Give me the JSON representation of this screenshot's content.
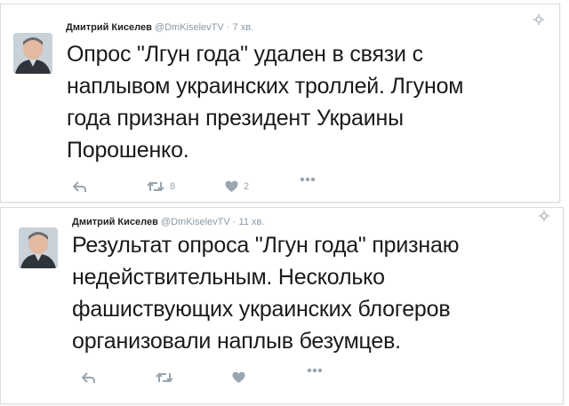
{
  "tweets": [
    {
      "author_name": "Дмитрий Киселев",
      "handle": "@DmKiselevTV",
      "separator": "·",
      "time": "7 хв.",
      "text_lines": [
        "Опрос \"Лгун года\" удален в связи с",
        "наплывом украинских троллей. Лгуном",
        "года признан президент Украины",
        "Порошенко."
      ],
      "retweet_count": "8",
      "like_count": "2",
      "icons": [
        "reply-icon",
        "retweet-icon",
        "like-icon",
        "more-icon",
        "follow-icon"
      ]
    },
    {
      "author_name": "Дмитрий Киселев",
      "handle": "@DmKiselevTV",
      "separator": "·",
      "time": "11 хв.",
      "text_lines": [
        "Результат опроса \"Лгун года\" признаю",
        "недействительным. Несколько",
        "фашиствующих украинских блогеров",
        "организовали наплыв безумцев."
      ],
      "retweet_count": "",
      "like_count": "",
      "icons": [
        "reply-icon",
        "retweet-icon",
        "like-icon",
        "more-icon",
        "follow-icon"
      ]
    }
  ],
  "colors": {
    "text": "#1a1a1a",
    "meta": "#8899a6",
    "icon": "#9aa5ae",
    "border": "#d8dde2"
  }
}
